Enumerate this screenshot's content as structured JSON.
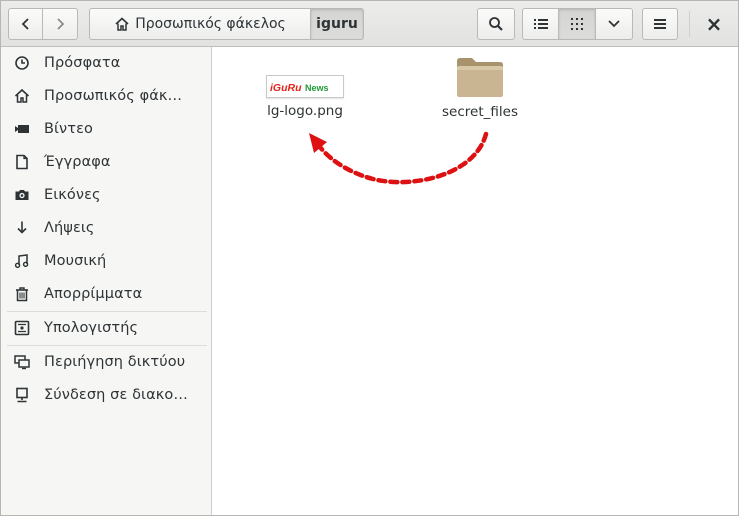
{
  "window": {
    "title": "iguru"
  },
  "toolbar": {
    "back_icon": "chevron-left-icon",
    "forward_icon": "chevron-right-icon",
    "path_home_label": "Προσωπικός φάκελος",
    "path_current_label": "iguru",
    "search_icon": "search-icon",
    "list_view_icon": "list-view-icon",
    "grid_view_icon": "grid-view-icon",
    "view_options_icon": "chevron-down-icon",
    "menu_icon": "hamburger-menu-icon",
    "close_label": "×"
  },
  "sidebar": {
    "items": [
      {
        "label": "Πρόσφατα",
        "icon": "clock-icon"
      },
      {
        "label": "Προσωπικός φάκ…",
        "icon": "home-icon"
      },
      {
        "label": "Βίντεο",
        "icon": "video-camera-icon"
      },
      {
        "label": "Έγγραφα",
        "icon": "document-icon"
      },
      {
        "label": "Εικόνες",
        "icon": "camera-icon"
      },
      {
        "label": "Λήψεις",
        "icon": "download-arrow-icon"
      },
      {
        "label": "Μουσική",
        "icon": "music-note-icon"
      },
      {
        "label": "Απορρίμματα",
        "icon": "trash-icon"
      },
      {
        "label": "Υπολογιστής",
        "icon": "drive-icon"
      },
      {
        "label": "Περιήγηση δικτύου",
        "icon": "network-icon"
      },
      {
        "label": "Σύνδεση σε διακο…",
        "icon": "server-icon"
      }
    ]
  },
  "files": [
    {
      "name": "lg-logo.png",
      "type": "image",
      "thumb_text": "iGuRu News"
    },
    {
      "name": "secret_files",
      "type": "folder"
    }
  ],
  "annotation": {
    "color": "#dd1111",
    "type": "dashed-curved-arrow",
    "from": "secret_files",
    "to": "lg-logo.png"
  },
  "colors": {
    "logo_red": "#e2231a",
    "logo_green": "#1f9a35",
    "folder": "#c9b592"
  }
}
